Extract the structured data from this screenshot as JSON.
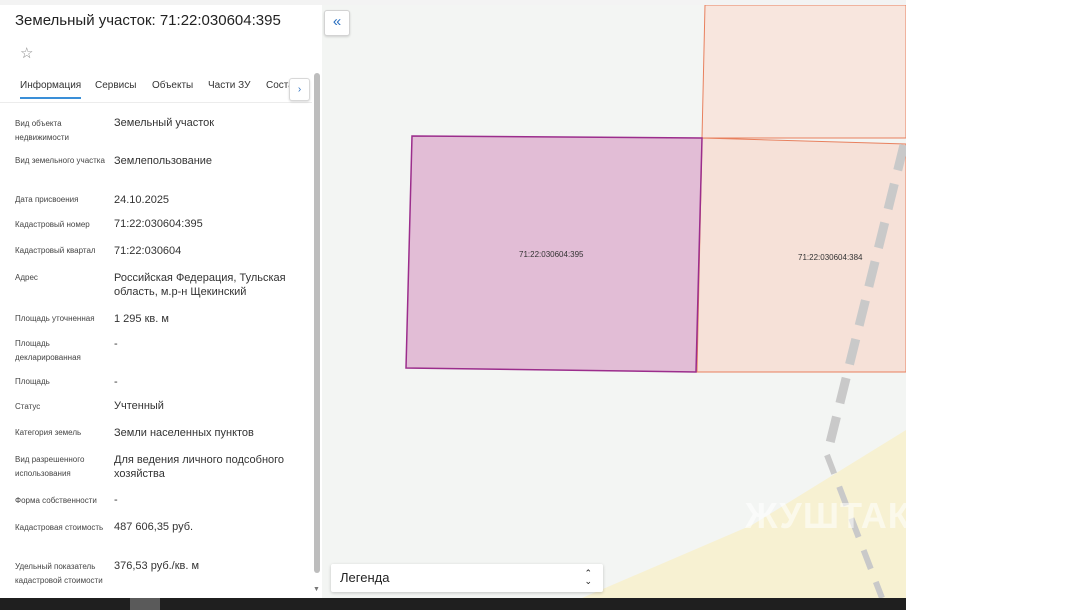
{
  "panel": {
    "title": "Земельный участок: 71:22:030604:395",
    "tabs": [
      "Информация",
      "Сервисы",
      "Объекты",
      "Части ЗУ",
      "Соста"
    ],
    "properties": [
      {
        "label": "Вид объекта недвижимости",
        "value": "Земельный участок"
      },
      {
        "label": "Вид земельного участка",
        "value": "Землепользование"
      },
      {
        "label": "Дата присвоения",
        "value": "24.10.2025"
      },
      {
        "label": "Кадастровый номер",
        "value": "71:22:030604:395"
      },
      {
        "label": "Кадастровый квартал",
        "value": "71:22:030604"
      },
      {
        "label": "Адрес",
        "value": "Российская Федерация, Тульская область, м.р-н Щекинский"
      },
      {
        "label": "Площадь уточненная",
        "value": "1 295 кв. м"
      },
      {
        "label": "Площадь декларированная",
        "value": "-"
      },
      {
        "label": "Площадь",
        "value": "-"
      },
      {
        "label": "Статус",
        "value": "Учтенный"
      },
      {
        "label": "Категория земель",
        "value": "Земли населенных пунктов"
      },
      {
        "label": "Вид разрешенного использования",
        "value": "Для ведения личного подсобного хозяйства"
      },
      {
        "label": "Форма собственности",
        "value": "-"
      },
      {
        "label": "Кадастровая стоимость",
        "value": "487 606,35 руб."
      },
      {
        "label": "Удельный показатель кадастровой стоимости",
        "value": "376,53 руб./кв. м"
      }
    ]
  },
  "map": {
    "parcel_selected_label": "71:22:030604:395",
    "parcel_neighbor_label": "71:22:030604:384",
    "legend_label": "Легенда",
    "watermark": "ЖУШТАК",
    "colors": {
      "selected_fill": "#e2bdd6",
      "selected_stroke": "#9b2d8c",
      "neighbor_fill": "#f6e1d8",
      "neighbor_stroke": "#e8805e",
      "zone_fill": "#f7f1d2"
    }
  },
  "icons": {
    "star": "☆",
    "collapse": "«",
    "tab_next": "›",
    "legend_toggle_up": "⌃",
    "legend_toggle_down": "⌄"
  }
}
